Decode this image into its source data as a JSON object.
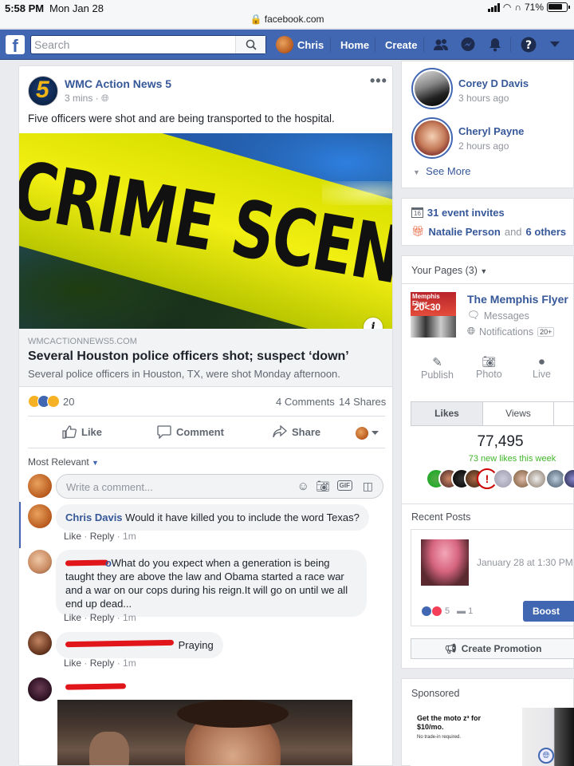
{
  "status": {
    "time": "5:58 PM",
    "date": "Mon Jan 28",
    "url": "facebook.com",
    "battery": "71%"
  },
  "header": {
    "search_placeholder": "Search",
    "user_name": "Chris",
    "home": "Home",
    "create": "Create"
  },
  "post": {
    "author": "WMC Action News 5",
    "meta": "3 mins",
    "text": "Five officers were shot and are being transported to the hospital.",
    "image_text": "CRIME SCENE DO",
    "link": {
      "domain": "WMCACTIONNEWS5.COM",
      "title": "Several Houston police officers shot; suspect ‘down’",
      "desc": "Several police officers in Houston, TX, were shot Monday afternoon."
    },
    "reaction_count": "20",
    "comments_count": "4 Comments",
    "shares_count": "14 Shares",
    "actions": {
      "like": "Like",
      "comment": "Comment",
      "share": "Share"
    },
    "sort_label": "Most Relevant",
    "comment_placeholder": "Write a comment...",
    "comments": [
      {
        "name": "Chris Davis",
        "text": "Would it have killed you to include the word Texas?",
        "like": "Like",
        "reply": "Reply",
        "time": "1m"
      },
      {
        "name_suffix": "o",
        "text": "What do you expect when a generation is being taught they are above the law and Obama started a race war and a war on our cops during his reign.It will go on until we all end up dead...",
        "like": "Like",
        "reply": "Reply",
        "time": "1m"
      },
      {
        "text": "Praying",
        "like": "Like",
        "reply": "Reply",
        "time": "1m"
      }
    ]
  },
  "sidebar": {
    "friends": [
      {
        "name": "Corey D Davis",
        "time": "3 hours ago"
      },
      {
        "name": "Cheryl Payne",
        "time": "2 hours ago"
      }
    ],
    "see_more": "See More",
    "event_invites": "31 event invites",
    "event_cal_day": "16",
    "birthday_name": "Natalie Person",
    "birthday_and": "and",
    "birthday_others": "6 others",
    "your_pages": "Your Pages (3)",
    "page_name": "The Memphis Flyer",
    "page_thumb_title": "Memphis Flyer",
    "page_thumb_num": "20<30",
    "messages": "Messages",
    "notifications": "Notifications",
    "notif_badge": "20+",
    "page_actions": [
      "Publish",
      "Photo",
      "Live"
    ],
    "tabs": [
      "Likes",
      "Views"
    ],
    "likes_count": "77,495",
    "new_likes": "73 new likes this week",
    "recent_posts": "Recent Posts",
    "recent_date": "January 28 at 1:30 PM",
    "recent_reactions": "5",
    "recent_comments": "1",
    "boost": "Boost Pos",
    "create_promotion": "Create Promotion",
    "sponsored": "Sponsored",
    "ad_headline": "Get the moto z³ for $10/mo.",
    "ad_sub": "No trade-in required."
  },
  "colors": {
    "brand": "#4267b2",
    "link": "#365899",
    "new_likes": "#42b72a"
  }
}
